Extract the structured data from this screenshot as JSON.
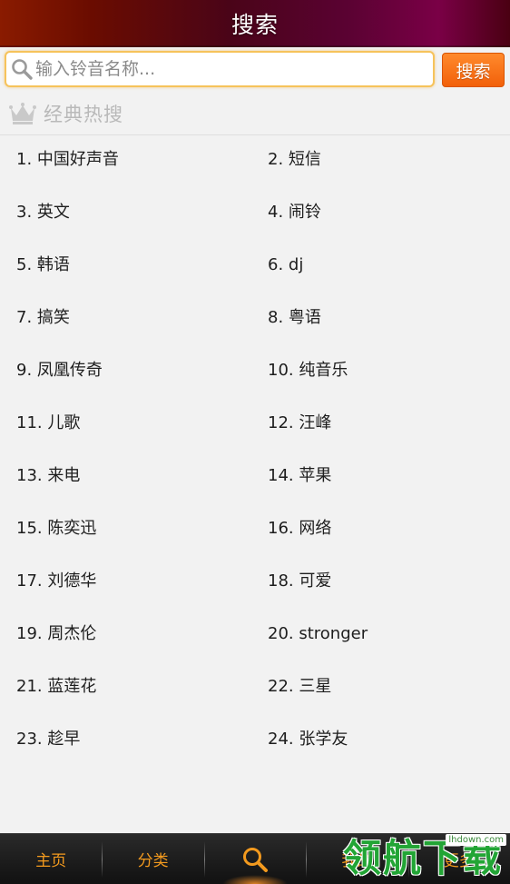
{
  "header": {
    "title": "搜索"
  },
  "search": {
    "placeholder": "输入铃音名称...",
    "value": "",
    "button_label": "搜索"
  },
  "hot_section": {
    "title": "经典热搜",
    "items": [
      "1. 中国好声音",
      "2. 短信",
      "3. 英文",
      "4. 闹铃",
      "5. 韩语",
      "6. dj",
      "7. 搞笑",
      "8. 粤语",
      "9. 凤凰传奇",
      "10. 纯音乐",
      "11. 儿歌",
      "12. 汪峰",
      "13. 来电",
      "14. 苹果",
      "15. 陈奕迅",
      "16. 网络",
      "17. 刘德华",
      "18. 可爱",
      "19. 周杰伦",
      "20. stronger",
      "21. 蓝莲花",
      "22. 三星",
      "23. 趁早",
      "24. 张学友"
    ]
  },
  "bottom_nav": {
    "tabs": [
      {
        "label": "主页",
        "active": false
      },
      {
        "label": "分类",
        "active": false
      },
      {
        "label": "",
        "icon": "search-icon",
        "active": true
      },
      {
        "label": "我的",
        "active": false
      },
      {
        "label": "更多",
        "active": false
      }
    ]
  },
  "watermark": {
    "text": "领航下载",
    "url": "lhdown.com"
  },
  "colors": {
    "accent": "#f2600a",
    "search_border": "#f6c35b",
    "nav_text": "#f39a1e",
    "watermark": "#22a535"
  }
}
